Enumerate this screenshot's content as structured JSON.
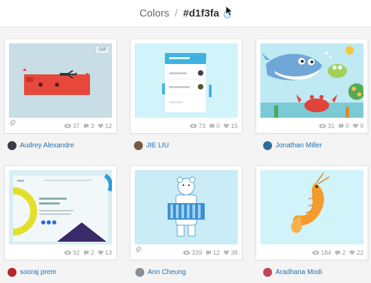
{
  "header": {
    "section": "Colors",
    "separator": "/",
    "color_hex": "#d1f3fa"
  },
  "colors": {
    "accent_blue": "#1e6fb4",
    "swatch": "#d1f3fa",
    "meta_text": "#999999"
  },
  "shots": [
    {
      "author": "Audrey Alexandre",
      "views": "37",
      "comments": "3",
      "likes": "12",
      "gif_badge": "GIF",
      "has_attachment": true
    },
    {
      "author": "JIE LIU",
      "views": "73",
      "comments": "0",
      "likes": "15",
      "has_attachment": false
    },
    {
      "author": "Jonathan Miller",
      "views": "31",
      "comments": "0",
      "likes": "9",
      "has_attachment": false
    },
    {
      "author": "sooraj prem",
      "views": "92",
      "comments": "2",
      "likes": "13",
      "has_attachment": false
    },
    {
      "author": "Ann Cheung",
      "views": "339",
      "comments": "12",
      "likes": "38",
      "has_attachment": true
    },
    {
      "author": "Aradhana Modi",
      "views": "184",
      "comments": "2",
      "likes": "22",
      "has_attachment": false
    }
  ]
}
